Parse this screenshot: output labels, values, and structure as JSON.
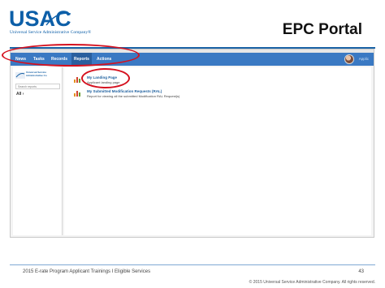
{
  "slide": {
    "logo": "USAC",
    "logo_sub": "Universal Service Administrative Company®",
    "title": "EPC Portal"
  },
  "navbar": {
    "items": [
      "News",
      "Tasks",
      "Records",
      "Reports",
      "Actions"
    ],
    "active": "Reports",
    "user": "Applic"
  },
  "sidebar": {
    "org": [
      "Universal Service",
      "Administrative Co"
    ],
    "search_placeholder": "Search reports",
    "filter": "All ›"
  },
  "reports": [
    {
      "title": "My Landing Page",
      "description": "Applicant landing page"
    },
    {
      "title": "My Submitted Modification Requests (RAL)",
      "description": "Report for viewing all the submitted Modification RAL Request(s)"
    }
  ],
  "footer": {
    "left": "2015 E-rate Program Applicant Trainings  I  Eligible Services",
    "page": "43",
    "copyright": "© 2015 Universal Service Administrative Company. All rights reserved."
  },
  "colors": {
    "navbar": "#3a79c3",
    "brand": "#0d5fa8",
    "highlight": "#d5101e"
  }
}
